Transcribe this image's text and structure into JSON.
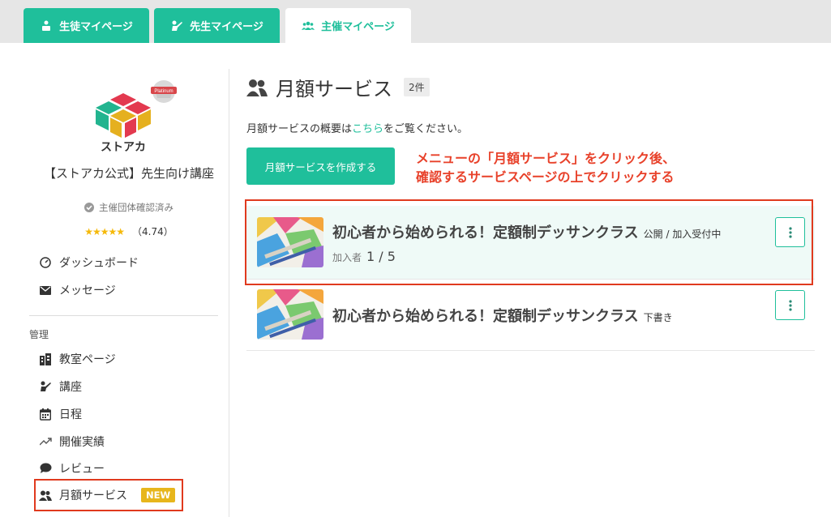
{
  "tabs": [
    {
      "label": "生徒マイページ",
      "icon": "student-icon"
    },
    {
      "label": "先生マイページ",
      "icon": "teacher-icon"
    },
    {
      "label": "主催マイページ",
      "icon": "group-icon"
    }
  ],
  "sidebar": {
    "logo_text": "ストアカ",
    "logo_badge": "Platinum",
    "org_name": "【ストアカ公式】先生向け講座",
    "verified_label": "主催団体確認済み",
    "rating_stars": "★★★★★",
    "rating_value": "（4.74）",
    "top_items": [
      {
        "label": "ダッシュボード",
        "icon": "dashboard-icon"
      },
      {
        "label": "メッセージ",
        "icon": "mail-icon"
      }
    ],
    "section_label": "管理",
    "manage_items": [
      {
        "label": "教室ページ",
        "icon": "building-icon"
      },
      {
        "label": "講座",
        "icon": "teacher-icon"
      },
      {
        "label": "日程",
        "icon": "calendar-icon"
      },
      {
        "label": "開催実績",
        "icon": "trend-icon"
      },
      {
        "label": "レビュー",
        "icon": "chat-icon"
      },
      {
        "label": "月額サービス",
        "icon": "users-icon",
        "badge": "NEW"
      }
    ]
  },
  "main": {
    "title": "月額サービス",
    "count": "2件",
    "desc_prefix": "月額サービスの概要は",
    "desc_link": "こちら",
    "desc_suffix": "をご覧ください。",
    "create_button": "月額サービスを作成する",
    "annotation_line1": "メニューの「月額サービス」をクリック後、",
    "annotation_line2": "確認するサービスページの上でクリックする",
    "services": [
      {
        "title": "初心者から始められる！定額制デッサンクラス",
        "status": "公開 / 加入受付中",
        "members_label": "加入者",
        "members_value": "1 / 5"
      },
      {
        "title": "初心者から始められる！定額制デッサンクラス",
        "status": "下書き"
      }
    ]
  },
  "colors": {
    "accent": "#1fbf9b",
    "annotation": "#e8412a",
    "new_badge": "#e7b61c"
  }
}
